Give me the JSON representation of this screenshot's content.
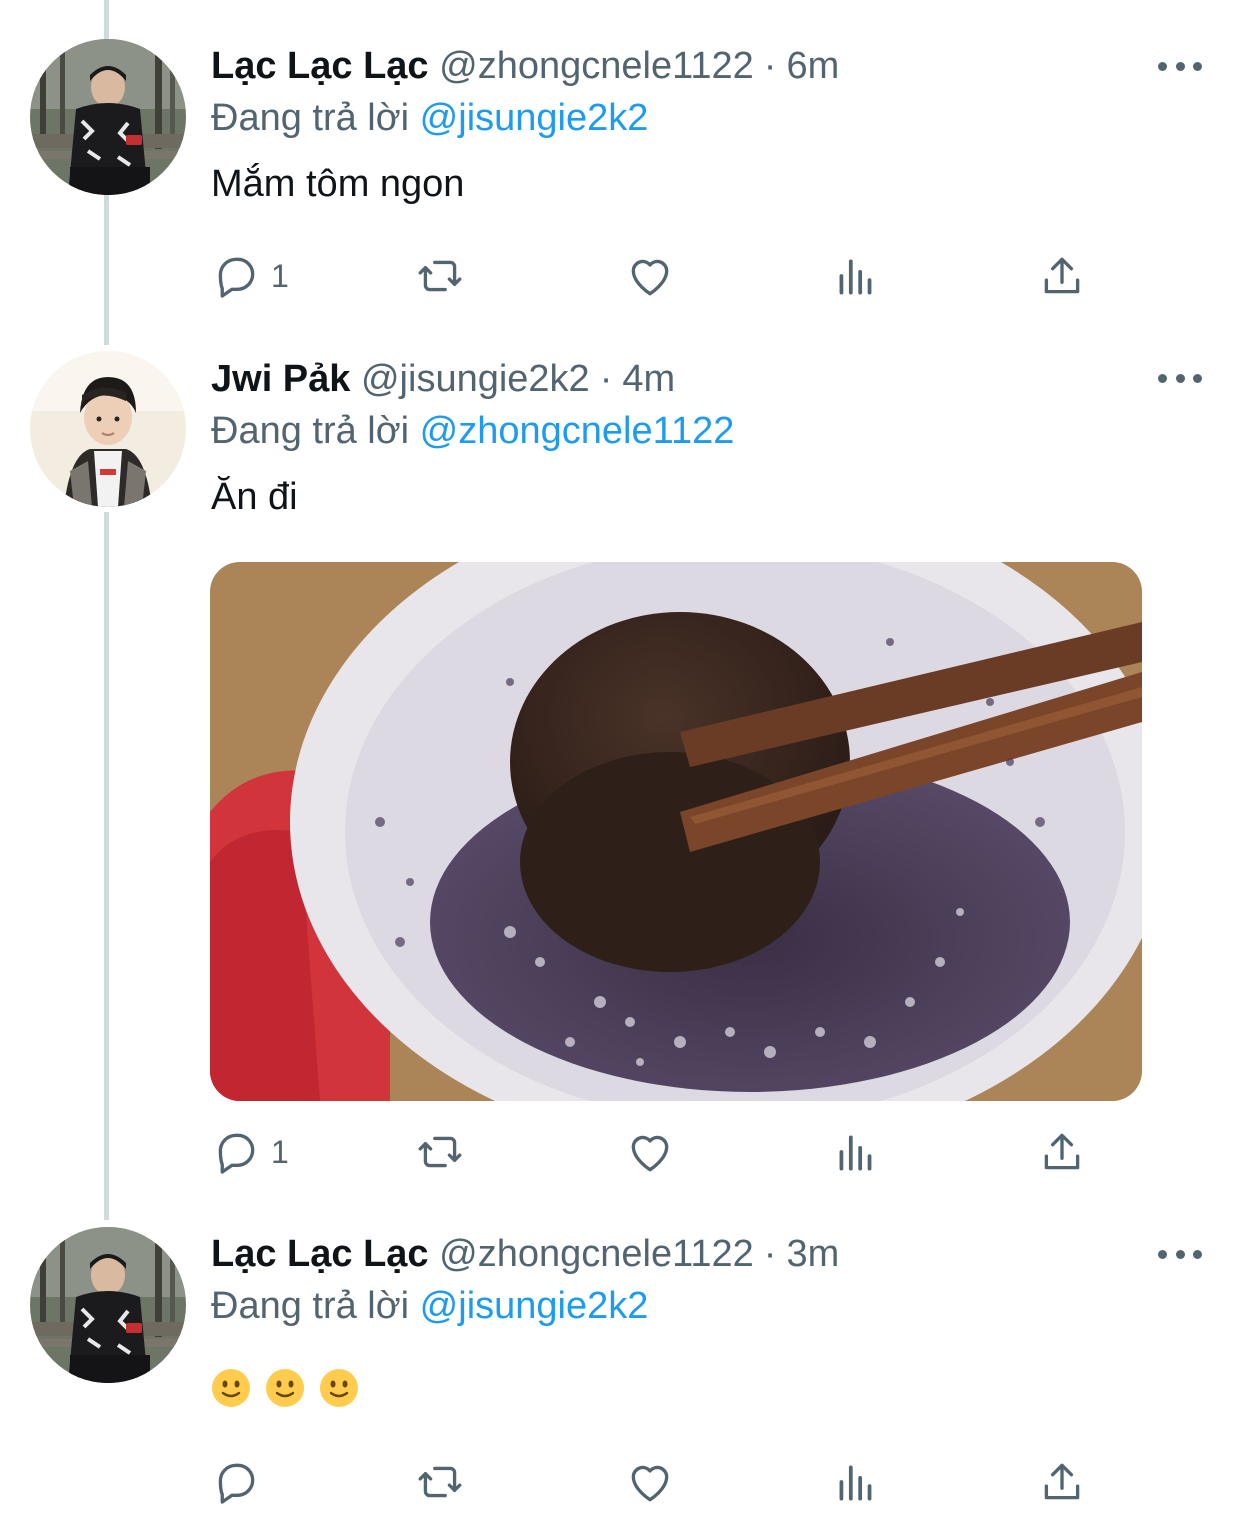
{
  "tweets": [
    {
      "display_name": "Lạc Lạc Lạc",
      "handle": "@zhongcnele1122",
      "time": "6m",
      "reply_prefix": "Đang trả lời",
      "reply_to": "@jisungie2k2",
      "text": "Mắm tôm ngon",
      "reply_count": "1"
    },
    {
      "display_name": "Jwi Pảk",
      "handle": "@jisungie2k2",
      "time": "4m",
      "reply_prefix": "Đang trả lời",
      "reply_to": "@zhongcnele1122",
      "text": "Ăn đi",
      "reply_count": "1"
    },
    {
      "display_name": "Lạc Lạc Lạc",
      "handle": "@zhongcnele1122",
      "time": "3m",
      "reply_prefix": "Đang trả lời",
      "reply_to": "@jisungie2k2",
      "text": "🙂🙂🙂",
      "reply_count": ""
    }
  ],
  "separator": "·",
  "icons": {
    "reply": "reply-icon",
    "retweet": "retweet-icon",
    "like": "heart-icon",
    "views": "views-icon",
    "share": "share-icon",
    "more": "more-icon"
  },
  "colors": {
    "text": "#0f1419",
    "secondary": "#536471",
    "link": "#1d9bf0",
    "thread_line": "#cfd9de"
  }
}
